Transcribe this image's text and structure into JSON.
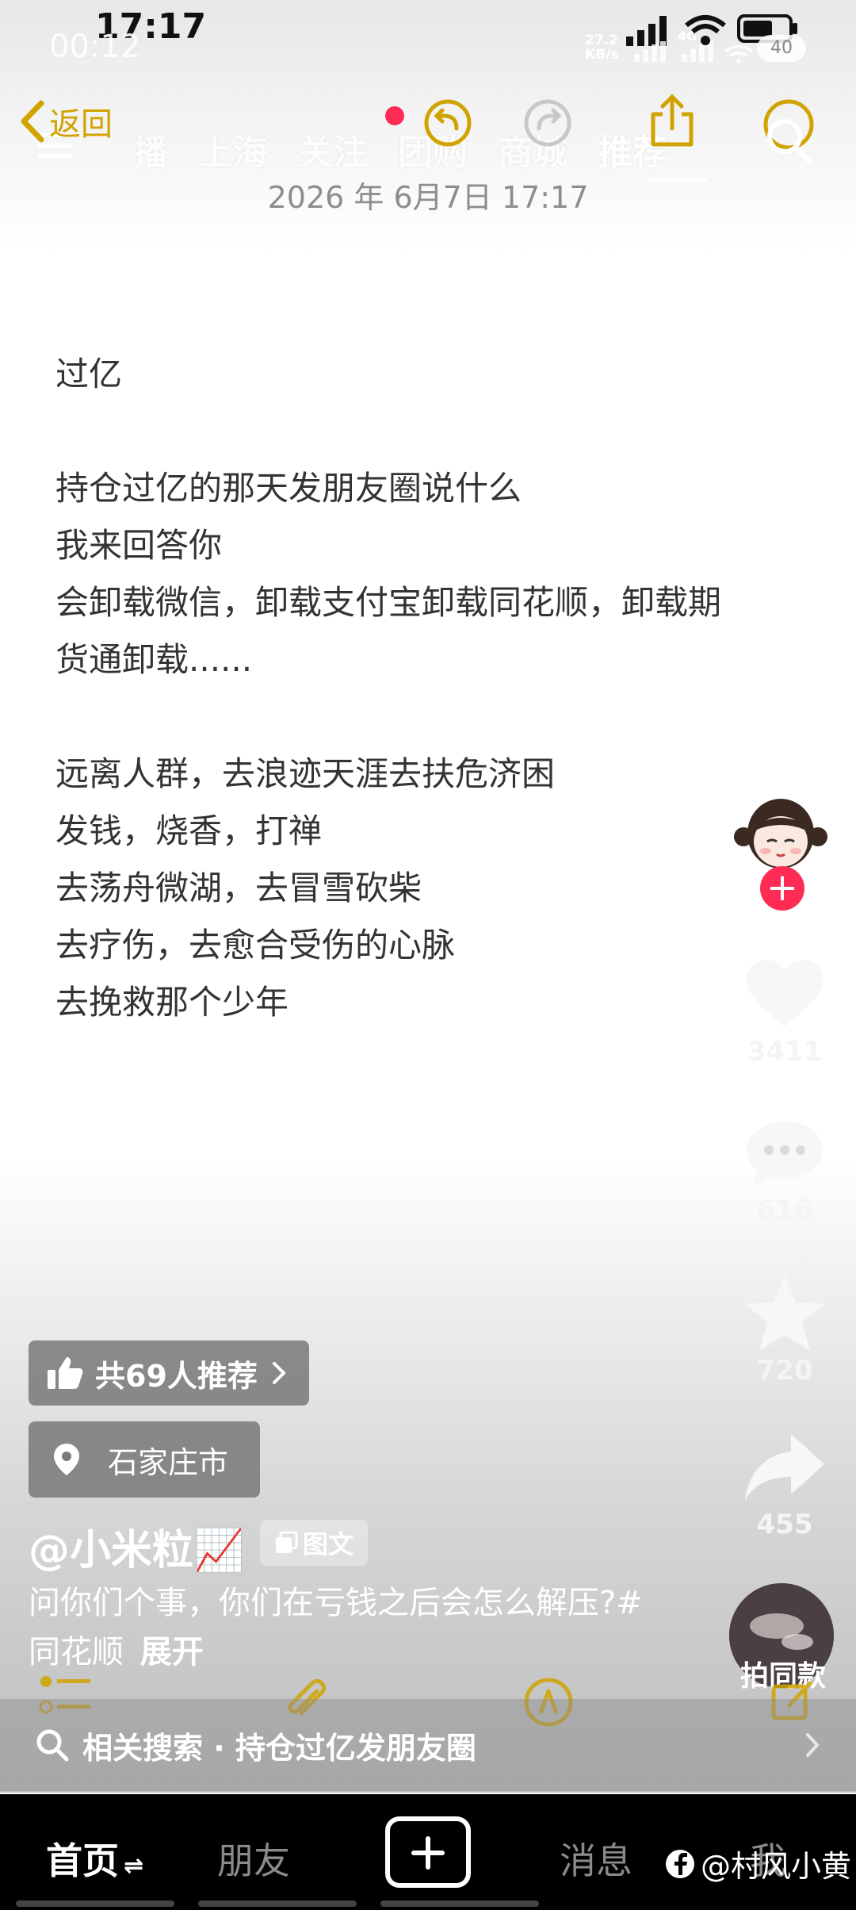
{
  "status_bar": {
    "time": "17:17",
    "overlay_time": "00:12",
    "speed": "27.2",
    "speed_unit": "KB/s",
    "network_badge": "5G",
    "network_badge_2": "4G",
    "battery": "40"
  },
  "nav": {
    "back_label": "返回",
    "tabs": [
      "播",
      "上海",
      "关注",
      "团购",
      "商城",
      "推荐"
    ],
    "active_tab": "推荐"
  },
  "note": {
    "date": "2026 年 6月7日 17:17",
    "title": "过亿",
    "lines": [
      "持仓过亿的那天发朋友圈说什么",
      "我来回答你",
      "会卸载微信，卸载支付宝卸载同花顺，卸载期",
      "货通卸载......",
      "远离人群，去浪迹天涯去扶危济困",
      "发钱，烧香，打禅",
      "去荡舟微湖，去冒雪砍柴",
      "去疗伤，去愈合受伤的心脉",
      "去挽救那个少年"
    ]
  },
  "rail": {
    "likes": "3411",
    "comments": "616",
    "favorites": "720",
    "shares": "455",
    "follow_symbol": "+",
    "same_style_label": "拍同款"
  },
  "info": {
    "recommend_label": "共69人推荐",
    "location_label": "石家庄市",
    "author": "@小米粒📈",
    "post_type": "图文",
    "description": "问你们个事，你们在亏钱之后会怎么解压?#同花顺",
    "expand_label": "展开",
    "related_search": "相关搜索 · 持仓过亿发朋友圈"
  },
  "tabbar": {
    "home": "首页",
    "friends": "朋友",
    "messages": "消息",
    "me": "我"
  },
  "watermark": "@村风小黄",
  "colors": {
    "accent_red": "#fe2c55",
    "notes_gold": "#d0a300"
  }
}
